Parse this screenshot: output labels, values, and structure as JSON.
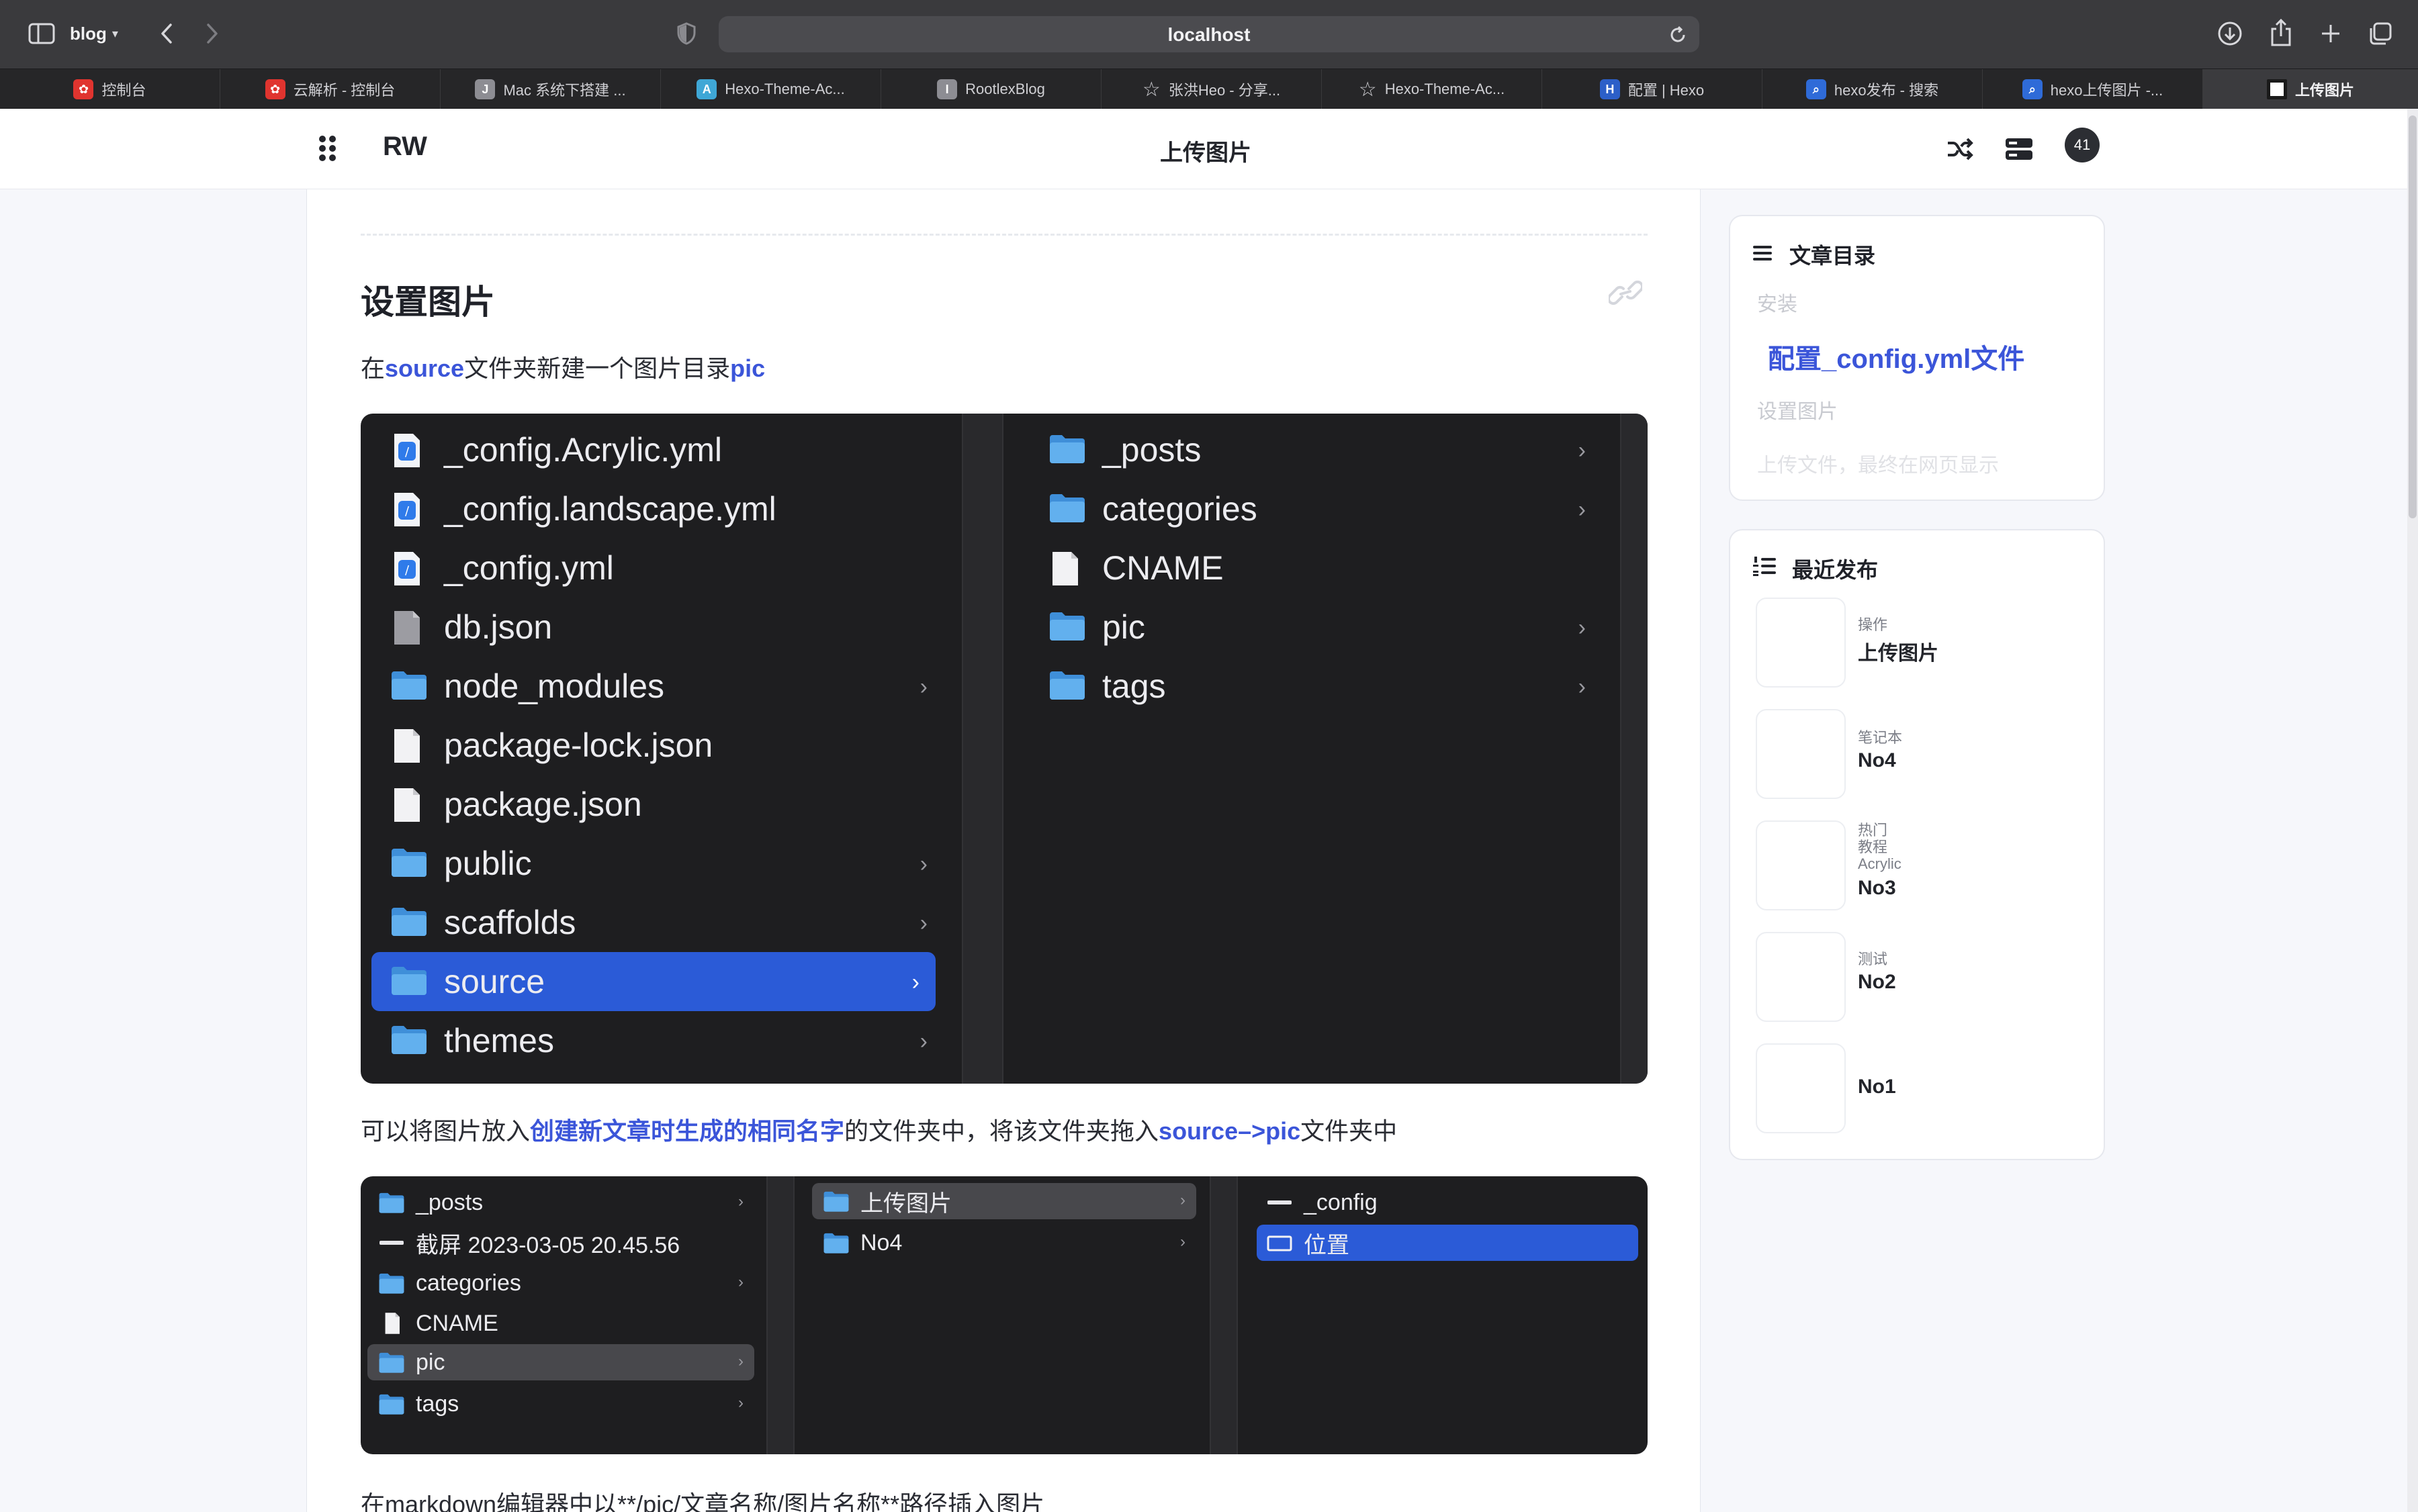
{
  "browser": {
    "profile_label": "blog",
    "url": "localhost",
    "tabs": [
      {
        "title": "控制台",
        "favicon": "huawei-icon"
      },
      {
        "title": "云解析 - 控制台",
        "favicon": "huawei-icon"
      },
      {
        "title": "Mac 系统下搭建 ...",
        "favicon": "j-icon"
      },
      {
        "title": "Hexo-Theme-Ac...",
        "favicon": "acrylic-icon"
      },
      {
        "title": "RootlexBlog",
        "favicon": "i-icon"
      },
      {
        "title": "张洪Heo - 分享...",
        "favicon": "star-icon"
      },
      {
        "title": "Hexo-Theme-Ac...",
        "favicon": "star-icon"
      },
      {
        "title": "配置 | Hexo",
        "favicon": "hexo-icon"
      },
      {
        "title": "hexo发布 - 搜索",
        "favicon": "search-icon"
      },
      {
        "title": "hexo上传图片 -...",
        "favicon": "search-icon"
      },
      {
        "title": "上传图片",
        "favicon": "site-icon"
      }
    ]
  },
  "site": {
    "brand": "RW",
    "page_title": "上传图片",
    "avatar_count": "41"
  },
  "article": {
    "section_heading": "设置图片",
    "para1": {
      "pre": "在",
      "kw1": "source",
      "mid": "文件夹新建一个图片目录",
      "kw2": "pic"
    },
    "finder1": {
      "left_column": [
        {
          "name": "_config.Acrylic.yml",
          "type": "yml"
        },
        {
          "name": "_config.landscape.yml",
          "type": "yml"
        },
        {
          "name": "_config.yml",
          "type": "yml"
        },
        {
          "name": "db.json",
          "type": "file-gray"
        },
        {
          "name": "node_modules",
          "type": "folder"
        },
        {
          "name": "package-lock.json",
          "type": "file"
        },
        {
          "name": "package.json",
          "type": "file"
        },
        {
          "name": "public",
          "type": "folder"
        },
        {
          "name": "scaffolds",
          "type": "folder"
        },
        {
          "name": "source",
          "type": "folder",
          "selected": true
        },
        {
          "name": "themes",
          "type": "folder"
        }
      ],
      "right_column": [
        {
          "name": "_posts",
          "type": "folder"
        },
        {
          "name": "categories",
          "type": "folder"
        },
        {
          "name": "CNAME",
          "type": "file"
        },
        {
          "name": "pic",
          "type": "folder"
        },
        {
          "name": "tags",
          "type": "folder"
        }
      ]
    },
    "para2": {
      "pre": "可以将图片放入",
      "kw1": "创建新文章时生成的相同名字",
      "mid": "的文件夹中，将该文件夹拖入",
      "kw2": "source–>pic",
      "post": "文件夹中"
    },
    "finder2": {
      "col1": [
        {
          "name": "_posts",
          "type": "folder"
        },
        {
          "name": "截屏 2023-03-05 20.45.56",
          "type": "image"
        },
        {
          "name": "categories",
          "type": "folder"
        },
        {
          "name": "CNAME",
          "type": "file"
        },
        {
          "name": "pic",
          "type": "folder",
          "highlighted": true
        },
        {
          "name": "tags",
          "type": "folder"
        }
      ],
      "col2": [
        {
          "name": "上传图片",
          "type": "folder",
          "highlighted": true
        },
        {
          "name": "No4",
          "type": "folder"
        }
      ],
      "col3": [
        {
          "name": "_config",
          "type": "image"
        },
        {
          "name": "位置",
          "type": "image",
          "selected": true
        }
      ]
    },
    "para3": "在markdown编辑器中以**/pic/文章名称/图片名称**路径插入图片"
  },
  "sidebar": {
    "toc": {
      "title": "文章目录",
      "items": [
        {
          "label": "安装",
          "active": false
        },
        {
          "label": "配置_config.yml文件",
          "active": true
        },
        {
          "label": "设置图片",
          "active": false
        },
        {
          "label": "上传文件，最终在网页显示",
          "active": false
        }
      ]
    },
    "recent": {
      "title": "最近发布",
      "posts": [
        {
          "category": "操作",
          "title": "上传图片"
        },
        {
          "category": "笔记本",
          "title": "No4"
        },
        {
          "category": "热门\n教程\nAcrylic",
          "title": "No3"
        },
        {
          "category": "测试",
          "title": "No2"
        },
        {
          "category": "",
          "title": "No1"
        }
      ]
    }
  },
  "colors": {
    "accent": "#3b55d9",
    "finder_bg": "#1e1e20",
    "finder_selection": "#2b5bd7",
    "folder_blue": "#5aa9ec"
  }
}
